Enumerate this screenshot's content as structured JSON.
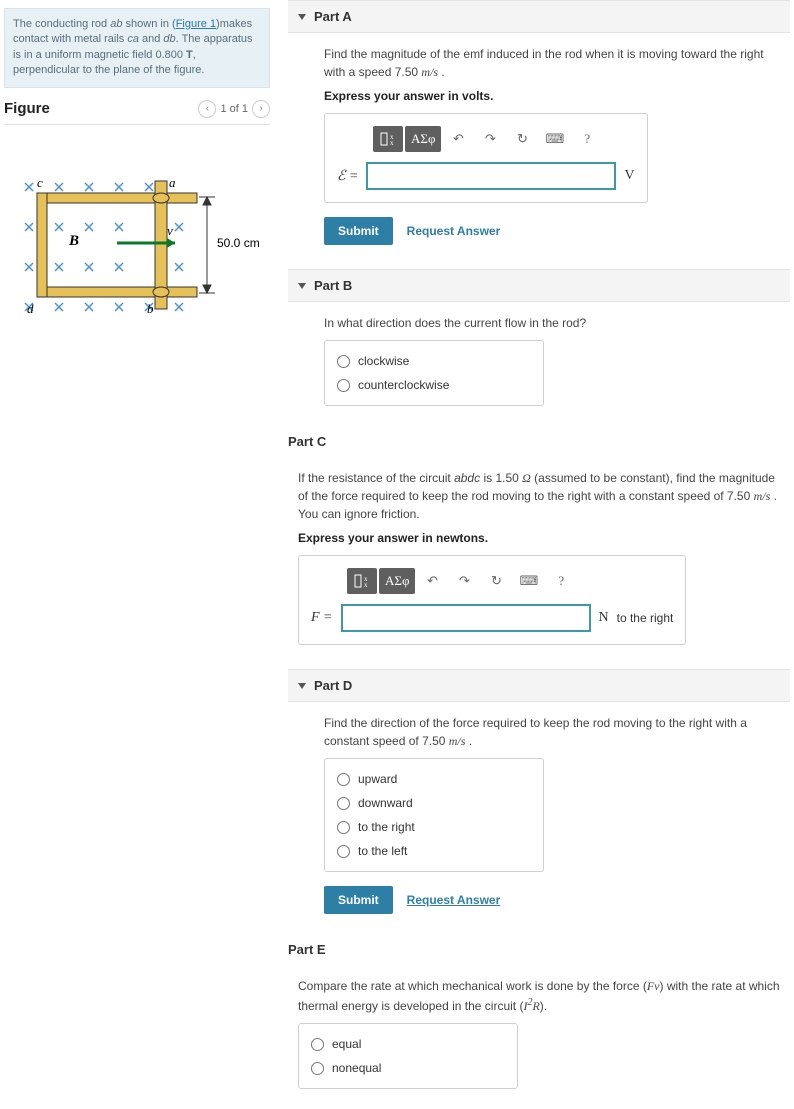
{
  "problem_intro_html": "The conducting rod <i>ab</i> shown in (<a href='#' data-name='figure-link' data-interactable='true'>Figure 1</a>)makes contact with metal rails <i>ca</i> and <i>db</i>. The apparatus is in a uniform magnetic field 0.800 <b>T</b>, perpendicular to the plane of the figure.",
  "figure_header": "Figure",
  "pager_text": "1 of 1",
  "figure_dimension": "50.0 cm",
  "partA": {
    "title": "Part A",
    "question": "Find the magnitude of the emf induced in the rod when it is moving toward the right with a speed 7.50 <span class='serif-i'>m/s</span> .",
    "express": "Express your answer in volts.",
    "symbol": "ℰ =",
    "unit": "V",
    "submit": "Submit",
    "request": "Request Answer"
  },
  "partB": {
    "title": "Part B",
    "question": "In what direction does the current flow in the rod?",
    "opt1": "clockwise",
    "opt2": "counterclockwise"
  },
  "partC": {
    "title": "Part C",
    "question": "If the resistance of the circuit <i>abdc</i> is 1.50 <span class='serif-i'>Ω</span> (assumed to be constant), find the magnitude of the force  required to keep the rod moving to the right with a constant speed of 7.50 <span class='serif-i'>m/s</span> . You can ignore friction.",
    "express": "Express your answer in newtons.",
    "symbol": "F =",
    "unit": "N",
    "unit_suffix": "to the right"
  },
  "partD": {
    "title": "Part D",
    "question": "Find the direction of the force  required to keep the rod moving to the right with a constant speed of 7.50 <span class='serif-i'>m/s</span> .",
    "opt1": "upward",
    "opt2": "downward",
    "opt3": "to the right",
    "opt4": "to the left",
    "submit": "Submit",
    "request": "Request Answer"
  },
  "partE": {
    "title": "Part E",
    "question": "Compare the rate at which mechanical work is done by the force (<span class='serif-i'>Fv</span>) with the rate at which thermal energy is developed in the circuit (<span class='serif-i'>I<sup>2</sup>R</span>).",
    "opt1": "equal",
    "opt2": "nonequal"
  },
  "toolbar": {
    "greek": "ΑΣφ",
    "help": "?"
  }
}
